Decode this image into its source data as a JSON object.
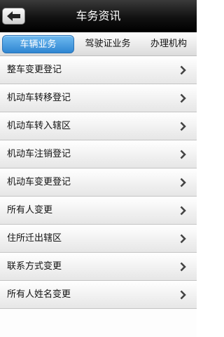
{
  "header": {
    "title": "车务资讯",
    "back_icon": "back-arrow-icon"
  },
  "tabs": [
    {
      "label": "车辆业务",
      "active": true
    },
    {
      "label": "驾驶证业务",
      "active": false
    },
    {
      "label": "办理机构",
      "active": false
    }
  ],
  "items": [
    {
      "label": "整车变更登记"
    },
    {
      "label": "机动车转移登记"
    },
    {
      "label": "机动车转入辖区"
    },
    {
      "label": "机动车注销登记"
    },
    {
      "label": "机动车变更登记"
    },
    {
      "label": "所有人变更"
    },
    {
      "label": "住所迁出辖区"
    },
    {
      "label": "联系方式变更"
    },
    {
      "label": "所有人姓名变更"
    }
  ],
  "colors": {
    "accent": "#2f86d2",
    "titlebar": "#121212"
  },
  "row_icon": "chevron-right-icon"
}
